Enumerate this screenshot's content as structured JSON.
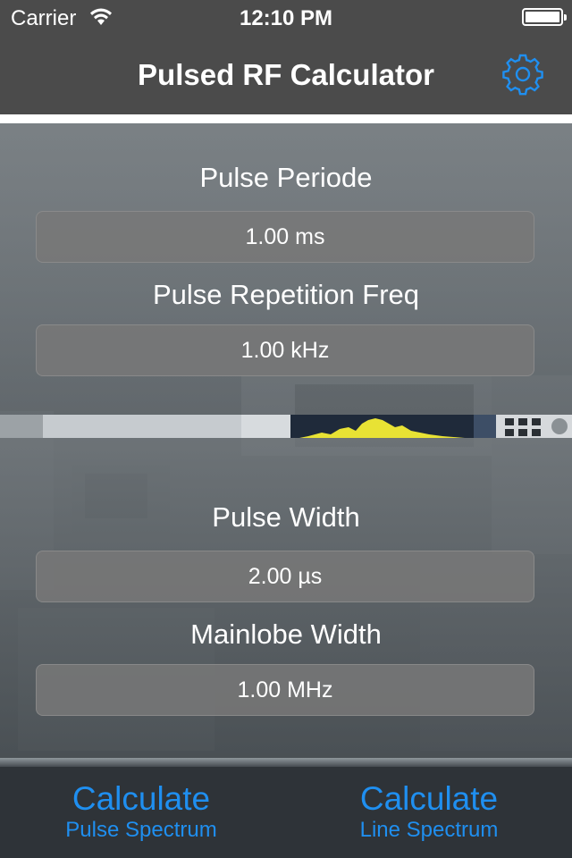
{
  "status_bar": {
    "carrier": "Carrier",
    "time": "12:10 PM"
  },
  "nav": {
    "title": "Pulsed RF Calculator",
    "settings_icon": "gear-icon"
  },
  "fields": {
    "pulse_period": {
      "label": "Pulse Periode",
      "value": "1.00 ms"
    },
    "prf": {
      "label": "Pulse Repetition Freq",
      "value": "1.00 kHz"
    },
    "pulse_width": {
      "label": "Pulse Width",
      "value": "2.00 µs"
    },
    "mainlobe_width": {
      "label": "Mainlobe Width",
      "value": "1.00 MHz"
    }
  },
  "buttons": {
    "pulse_spectrum": {
      "title": "Calculate",
      "subtitle": "Pulse Spectrum"
    },
    "line_spectrum": {
      "title": "Calculate",
      "subtitle": "Line Spectrum"
    }
  },
  "colors": {
    "accent": "#1f8ff0",
    "bar": "#4b4b4b"
  }
}
